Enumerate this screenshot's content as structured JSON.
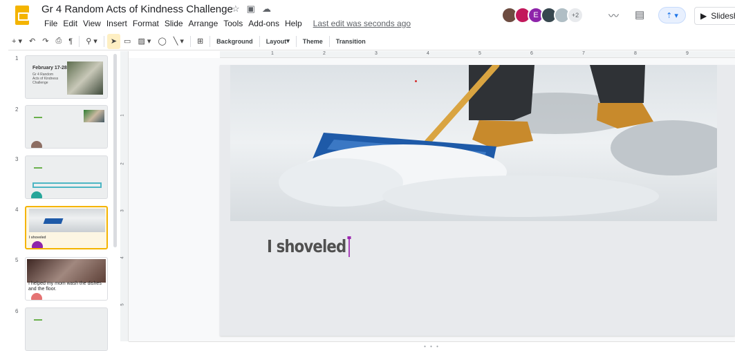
{
  "header": {
    "doc_title": "Gr 4 Random Acts of Kindness Challenge",
    "last_edit": "Last edit was seconds ago",
    "collaborator_letter": "E",
    "more_collaborators": "+2",
    "slideshow_label": "Slideshow"
  },
  "menu": [
    "File",
    "Edit",
    "View",
    "Insert",
    "Format",
    "Slide",
    "Arrange",
    "Tools",
    "Add-ons",
    "Help"
  ],
  "toolbar": {
    "background": "Background",
    "layout": "Layout",
    "theme": "Theme",
    "transition": "Transition"
  },
  "ruler": [
    "1",
    "2",
    "3",
    "4",
    "5",
    "6",
    "7",
    "8",
    "9"
  ],
  "vruler": [
    "1",
    "2",
    "3",
    "4",
    "5"
  ],
  "slides": [
    {
      "num": "1",
      "title": "February 17-28",
      "sub": "Gr 4 Random Acts of Kindness Challenge"
    },
    {
      "num": "2"
    },
    {
      "num": "3"
    },
    {
      "num": "4",
      "text": "I shoveled"
    },
    {
      "num": "5",
      "text": "I helped my mom wash the dishes and the floor."
    },
    {
      "num": "6"
    }
  ],
  "slide": {
    "heading": "I shoveled"
  },
  "colors": {
    "brand": "#f4b400",
    "accent": "#1a73e8",
    "cursor": "#9c27b0"
  }
}
